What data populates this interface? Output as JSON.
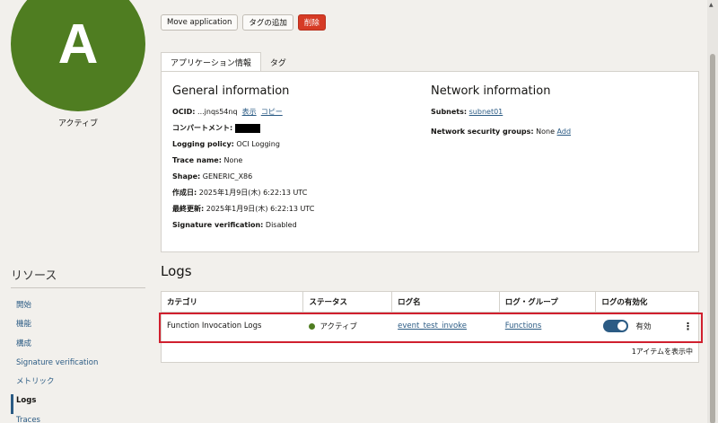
{
  "application": {
    "avatar_letter": "A",
    "state": "アクティブ"
  },
  "actions": {
    "move": "Move application",
    "add_tag": "タグの追加",
    "delete": "削除"
  },
  "tabs": [
    {
      "label": "アプリケーション情報",
      "selected": true
    },
    {
      "label": "タグ",
      "selected": false
    }
  ],
  "general": {
    "heading": "General information",
    "ocid_label": "OCID:",
    "ocid_value": "...jnqs54nq",
    "show": "表示",
    "copy": "コピー",
    "compartment_label": "コンパートメント:",
    "logging_label": "Logging policy:",
    "logging_value": "OCI Logging",
    "trace_label": "Trace name:",
    "trace_value": "None",
    "shape_label": "Shape:",
    "shape_value": "GENERIC_X86",
    "created_label": "作成日:",
    "created_value": "2025年1月9日(木) 6:22:13 UTC",
    "updated_label": "最終更新:",
    "updated_value": "2025年1月9日(木) 6:22:13 UTC",
    "signature_label": "Signature verification:",
    "signature_value": "Disabled"
  },
  "network": {
    "heading": "Network information",
    "subnets_label": "Subnets:",
    "subnets_value": "subnet01",
    "nsg_label": "Network security groups:",
    "nsg_value": "None",
    "nsg_add": "Add"
  },
  "resources": {
    "title": "リソース",
    "items": [
      {
        "label": "開始"
      },
      {
        "label": "機能"
      },
      {
        "label": "構成"
      },
      {
        "label": "Signature verification"
      },
      {
        "label": "メトリック"
      },
      {
        "label": "Logs",
        "active": true
      },
      {
        "label": "Traces"
      }
    ]
  },
  "logs": {
    "title": "Logs",
    "columns": [
      "カテゴリ",
      "ステータス",
      "ログ名",
      "ログ・グループ",
      "ログの有効化"
    ],
    "rows": [
      {
        "category": "Function Invocation Logs",
        "status": "アクティブ",
        "log_name": "event_test_invoke",
        "log_group": "Functions",
        "enabled_label": "有効",
        "enabled": true
      }
    ],
    "footer": "1アイテムを表示中"
  },
  "colors": {
    "accent": "#2b5b84",
    "active_green": "#4f7d21",
    "danger": "#d63b25",
    "highlight": "#d0202e"
  }
}
